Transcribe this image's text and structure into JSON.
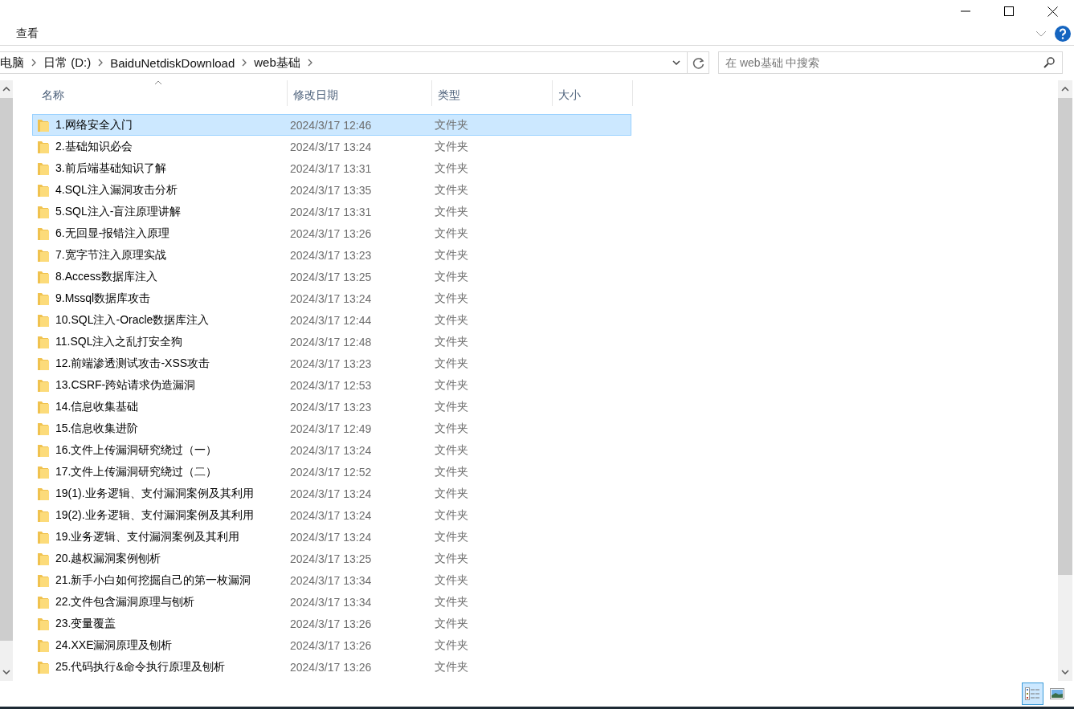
{
  "ribbon_tab": "查看",
  "breadcrumb": [
    "电脑",
    "日常 (D:)",
    "BaiduNetdiskDownload",
    "web基础"
  ],
  "search": {
    "placeholder": "在 web基础 中搜索"
  },
  "columns": [
    "名称",
    "修改日期",
    "类型",
    "大小"
  ],
  "rows": [
    {
      "name": "1.网络安全入门",
      "modified": "2024/3/17 12:46",
      "type": "文件夹",
      "selected": true
    },
    {
      "name": "2.基础知识必会",
      "modified": "2024/3/17 13:24",
      "type": "文件夹",
      "selected": false
    },
    {
      "name": "3.前后端基础知识了解",
      "modified": "2024/3/17 13:31",
      "type": "文件夹",
      "selected": false
    },
    {
      "name": "4.SQL注入漏洞攻击分析",
      "modified": "2024/3/17 13:35",
      "type": "文件夹",
      "selected": false
    },
    {
      "name": "5.SQL注入-盲注原理讲解",
      "modified": "2024/3/17 13:31",
      "type": "文件夹",
      "selected": false
    },
    {
      "name": "6.无回显-报错注入原理",
      "modified": "2024/3/17 13:26",
      "type": "文件夹",
      "selected": false
    },
    {
      "name": "7.宽字节注入原理实战",
      "modified": "2024/3/17 13:23",
      "type": "文件夹",
      "selected": false
    },
    {
      "name": "8.Access数据库注入",
      "modified": "2024/3/17 13:25",
      "type": "文件夹",
      "selected": false
    },
    {
      "name": "9.Mssql数据库攻击",
      "modified": "2024/3/17 13:24",
      "type": "文件夹",
      "selected": false
    },
    {
      "name": "10.SQL注入-Oracle数据库注入",
      "modified": "2024/3/17 12:44",
      "type": "文件夹",
      "selected": false
    },
    {
      "name": "11.SQL注入之乱打安全狗",
      "modified": "2024/3/17 12:48",
      "type": "文件夹",
      "selected": false
    },
    {
      "name": "12.前端渗透测试攻击-XSS攻击",
      "modified": "2024/3/17 13:23",
      "type": "文件夹",
      "selected": false
    },
    {
      "name": "13.CSRF-跨站请求伪造漏洞",
      "modified": "2024/3/17 12:53",
      "type": "文件夹",
      "selected": false
    },
    {
      "name": "14.信息收集基础",
      "modified": "2024/3/17 13:23",
      "type": "文件夹",
      "selected": false
    },
    {
      "name": "15.信息收集进阶",
      "modified": "2024/3/17 12:49",
      "type": "文件夹",
      "selected": false
    },
    {
      "name": "16.文件上传漏洞研究绕过（一）",
      "modified": "2024/3/17 13:24",
      "type": "文件夹",
      "selected": false
    },
    {
      "name": "17.文件上传漏洞研究绕过（二）",
      "modified": "2024/3/17 12:52",
      "type": "文件夹",
      "selected": false
    },
    {
      "name": "19(1).业务逻辑、支付漏洞案例及其利用",
      "modified": "2024/3/17 13:24",
      "type": "文件夹",
      "selected": false
    },
    {
      "name": "19(2).业务逻辑、支付漏洞案例及其利用",
      "modified": "2024/3/17 13:24",
      "type": "文件夹",
      "selected": false
    },
    {
      "name": "19.业务逻辑、支付漏洞案例及其利用",
      "modified": "2024/3/17 13:24",
      "type": "文件夹",
      "selected": false
    },
    {
      "name": "20.越权漏洞案例刨析",
      "modified": "2024/3/17 13:25",
      "type": "文件夹",
      "selected": false
    },
    {
      "name": "21.新手小白如何挖掘自己的第一枚漏洞",
      "modified": "2024/3/17 13:34",
      "type": "文件夹",
      "selected": false
    },
    {
      "name": "22.文件包含漏洞原理与刨析",
      "modified": "2024/3/17 13:34",
      "type": "文件夹",
      "selected": false
    },
    {
      "name": "23.变量覆盖",
      "modified": "2024/3/17 13:26",
      "type": "文件夹",
      "selected": false
    },
    {
      "name": "24.XXE漏洞原理及刨析",
      "modified": "2024/3/17 13:26",
      "type": "文件夹",
      "selected": false
    },
    {
      "name": "25.代码执行&命令执行原理及刨析",
      "modified": "2024/3/17 13:26",
      "type": "文件夹",
      "selected": false
    }
  ],
  "view_modes": [
    {
      "kind": "details",
      "selected": true
    },
    {
      "kind": "large-icons",
      "selected": false
    }
  ]
}
